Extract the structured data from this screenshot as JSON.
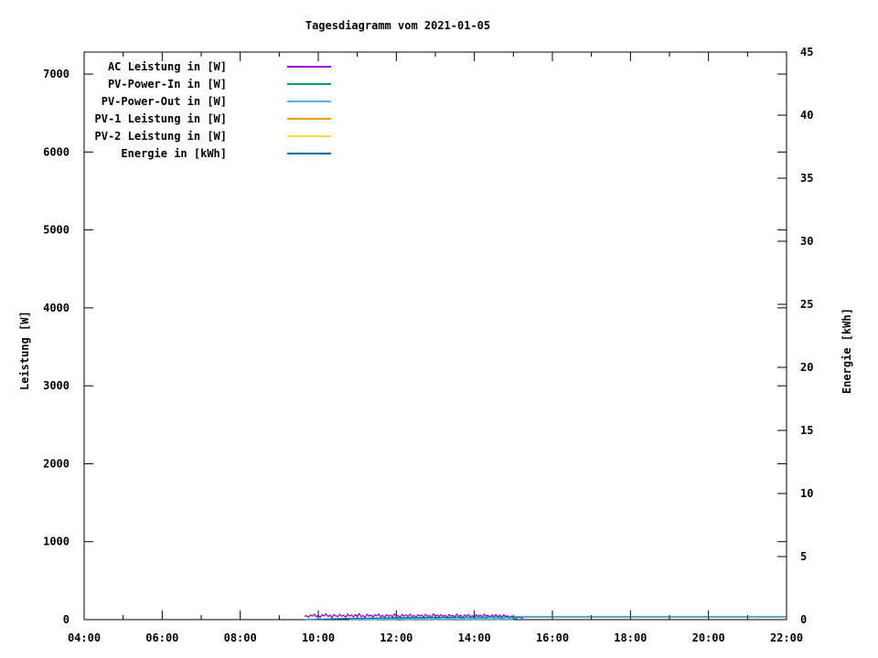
{
  "title": "Tagesdiagramm vom 2021-01-05",
  "chart_data": {
    "type": "line",
    "title": "Tagesdiagramm vom 2021-01-05",
    "ylabel_left": "Leistung [W]",
    "ylabel_right": "Energie [kWh]",
    "grid": false,
    "legend_position": "top-left-inside",
    "x_range_hours": [
      4,
      22
    ],
    "x_ticks": [
      {
        "h": 4,
        "label": "04:00"
      },
      {
        "h": 6,
        "label": "06:00"
      },
      {
        "h": 8,
        "label": "08:00"
      },
      {
        "h": 10,
        "label": "10:00"
      },
      {
        "h": 12,
        "label": "12:00"
      },
      {
        "h": 14,
        "label": "14:00"
      },
      {
        "h": 16,
        "label": "16:00"
      },
      {
        "h": 18,
        "label": "18:00"
      },
      {
        "h": 20,
        "label": "20:00"
      },
      {
        "h": 22,
        "label": "22:00"
      }
    ],
    "x_minor_hours": [
      5,
      7,
      9,
      11,
      13,
      15,
      17,
      19,
      21
    ],
    "y_left": {
      "range": [
        0,
        7282
      ],
      "ticks": [
        0,
        1000,
        2000,
        3000,
        4000,
        5000,
        6000,
        7000
      ]
    },
    "y_right": {
      "range": [
        0,
        45
      ],
      "ticks": [
        0,
        5,
        10,
        15,
        20,
        25,
        30,
        35,
        40,
        45
      ]
    },
    "series": [
      {
        "name": "AC Leistung in [W]",
        "color": "#9400d3",
        "axis": "left",
        "x_start": 9.65,
        "x_step": 0.05,
        "values": [
          38,
          52,
          30,
          61,
          44,
          70,
          35,
          55,
          28,
          63,
          47,
          74,
          40,
          58,
          25,
          66,
          49,
          36,
          68,
          43,
          57,
          31,
          72,
          46,
          60,
          34,
          64,
          41,
          76,
          38,
          53,
          27,
          69,
          45,
          59,
          33,
          62,
          48,
          71,
          37,
          54,
          29,
          65,
          42,
          57,
          35,
          73,
          44,
          50,
          31,
          67,
          46,
          61,
          36,
          70,
          40,
          55,
          26,
          63,
          48,
          58,
          33,
          68,
          43,
          52,
          30,
          74,
          45,
          60,
          37,
          64,
          41,
          56,
          28,
          66,
          47,
          53,
          34,
          71,
          39,
          58,
          25,
          62,
          44,
          68,
          36,
          51,
          30,
          65,
          42,
          59,
          33,
          70,
          46,
          54,
          29,
          61,
          40,
          67,
          35,
          57,
          31,
          63,
          43,
          49,
          27,
          45,
          33,
          38,
          26,
          31,
          22,
          16
        ]
      },
      {
        "name": "PV-Power-In in [W]",
        "color": "#009e73",
        "axis": "left",
        "x_start": 10.6,
        "x_step": 0.1,
        "values": [
          10,
          14,
          9,
          15,
          12,
          16,
          8,
          13,
          11,
          17,
          10,
          14,
          12,
          18,
          9,
          15,
          11,
          16,
          10,
          13,
          12,
          17,
          9,
          14,
          11,
          15,
          8,
          16,
          12,
          13,
          10,
          17,
          9,
          15,
          11,
          14,
          12,
          16,
          8,
          13,
          10,
          15,
          9,
          12,
          11,
          14
        ]
      },
      {
        "name": "PV-Power-Out in [W]",
        "color": "#56b4e9",
        "axis": "left",
        "x_start": 10.8,
        "x_step": 0.1,
        "values": [
          4,
          6,
          3,
          7,
          5,
          6,
          2,
          5,
          4,
          7,
          3,
          6,
          5,
          8,
          3,
          6,
          4,
          7,
          3,
          5,
          4,
          6,
          2,
          5,
          4,
          6,
          3,
          7,
          5,
          4,
          3,
          6,
          2,
          5,
          4,
          6,
          3,
          5,
          2,
          4,
          3,
          5,
          2
        ]
      },
      {
        "name": "PV-1 Leistung in [W]",
        "color": "#e69f00",
        "axis": "left",
        "values": []
      },
      {
        "name": "PV-2 Leistung in [W]",
        "color": "#f0e442",
        "axis": "left",
        "values": []
      },
      {
        "name": "Energie in [kWh]",
        "color": "#0072b2",
        "axis": "right",
        "points": [
          [
            9.65,
            0.0
          ],
          [
            10.0,
            0.03
          ],
          [
            10.5,
            0.07
          ],
          [
            11.0,
            0.1
          ],
          [
            11.5,
            0.13
          ],
          [
            12.0,
            0.15
          ],
          [
            12.5,
            0.17
          ],
          [
            13.0,
            0.18
          ],
          [
            13.5,
            0.19
          ],
          [
            14.0,
            0.2
          ],
          [
            14.5,
            0.21
          ],
          [
            15.0,
            0.21
          ],
          [
            15.4,
            0.22
          ],
          [
            22.0,
            0.22
          ]
        ]
      }
    ]
  }
}
